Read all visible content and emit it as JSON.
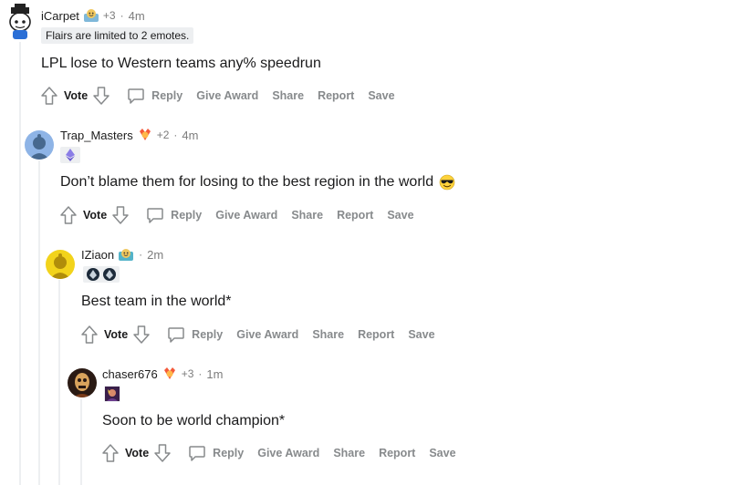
{
  "comments": [
    {
      "username": "iCarpet",
      "award_count": "+3",
      "separator": "·",
      "time": "4m",
      "flair_text": "Flairs are limited to 2 emotes.",
      "body": "LPL lose to Western teams any% speedrun",
      "actions": {
        "vote": "Vote",
        "reply": "Reply",
        "give_award": "Give Award",
        "share": "Share",
        "report": "Report",
        "save": "Save"
      }
    },
    {
      "username": "Trap_Masters",
      "award_count": "+2",
      "separator": "·",
      "time": "4m",
      "body": "Don’t blame them for losing to the best region in the world",
      "body_emoji": "sunglasses-emoji",
      "actions": {
        "vote": "Vote",
        "reply": "Reply",
        "give_award": "Give Award",
        "share": "Share",
        "report": "Report",
        "save": "Save"
      }
    },
    {
      "username": "IZiaon",
      "separator": "·",
      "time": "2m",
      "body": "Best team in the world*",
      "actions": {
        "vote": "Vote",
        "reply": "Reply",
        "give_award": "Give Award",
        "share": "Share",
        "report": "Report",
        "save": "Save"
      }
    },
    {
      "username": "chaser676",
      "award_count": "+3",
      "separator": "·",
      "time": "1m",
      "body": "Soon to be world champion*",
      "actions": {
        "vote": "Vote",
        "reply": "Reply",
        "give_award": "Give Award",
        "share": "Share",
        "report": "Report",
        "save": "Save"
      }
    }
  ],
  "colors": {
    "meta_gray": "#7c7c7c",
    "action_gray": "#878a8c",
    "flair_bg": "#edeff1",
    "thread_line": "#edeff1"
  }
}
